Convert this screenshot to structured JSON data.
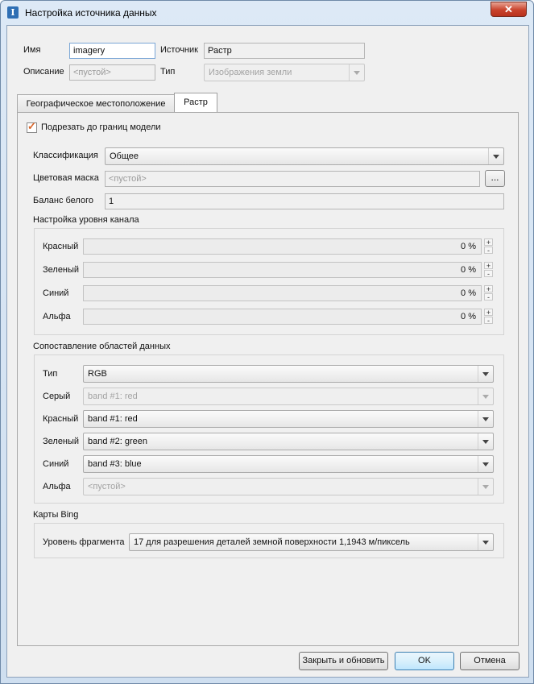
{
  "window": {
    "title": "Настройка источника данных"
  },
  "header": {
    "name_label": "Имя",
    "name_value": "imagery",
    "source_label": "Источник",
    "source_value": "Растр",
    "description_label": "Описание",
    "description_placeholder": "<пустой>",
    "type_label": "Тип",
    "type_value": "Изображения земли"
  },
  "tabs": [
    {
      "label": "Географическое местоположение",
      "selected": false
    },
    {
      "label": "Растр",
      "selected": true
    }
  ],
  "raster": {
    "clip_label": "Подрезать до границ модели",
    "clip_checked": true,
    "classification_label": "Классификация",
    "classification_value": "Общее",
    "color_mask_label": "Цветовая маска",
    "color_mask_placeholder": "<пустой>",
    "browse_label": "...",
    "white_balance_label": "Баланс белого",
    "white_balance_value": "1",
    "channel_levels": {
      "title": "Настройка уровня канала",
      "rows": [
        {
          "label": "Красный",
          "value": "0 %"
        },
        {
          "label": "Зеленый",
          "value": "0 %"
        },
        {
          "label": "Синий",
          "value": "0 %"
        },
        {
          "label": "Альфа",
          "value": "0 %"
        }
      ],
      "plus": "+",
      "minus": "-"
    },
    "band_mapping": {
      "title": "Сопоставление областей данных",
      "rows": [
        {
          "label": "Тип",
          "value": "RGB",
          "disabled": false
        },
        {
          "label": "Серый",
          "value": "band #1: red",
          "disabled": true
        },
        {
          "label": "Красный",
          "value": "band #1: red",
          "disabled": false
        },
        {
          "label": "Зеленый",
          "value": "band #2: green",
          "disabled": false
        },
        {
          "label": "Синий",
          "value": "band #3: blue",
          "disabled": false
        },
        {
          "label": "Альфа",
          "value": "<пустой>",
          "disabled": true
        }
      ]
    },
    "bing": {
      "title": "Карты Bing",
      "level_label": "Уровень фрагмента",
      "level_value": "17 для разрешения деталей земной поверхности 1,1943 м/пиксель"
    }
  },
  "buttons": {
    "close_update": "Закрыть и обновить",
    "ok": "OK",
    "cancel": "Отмена"
  }
}
